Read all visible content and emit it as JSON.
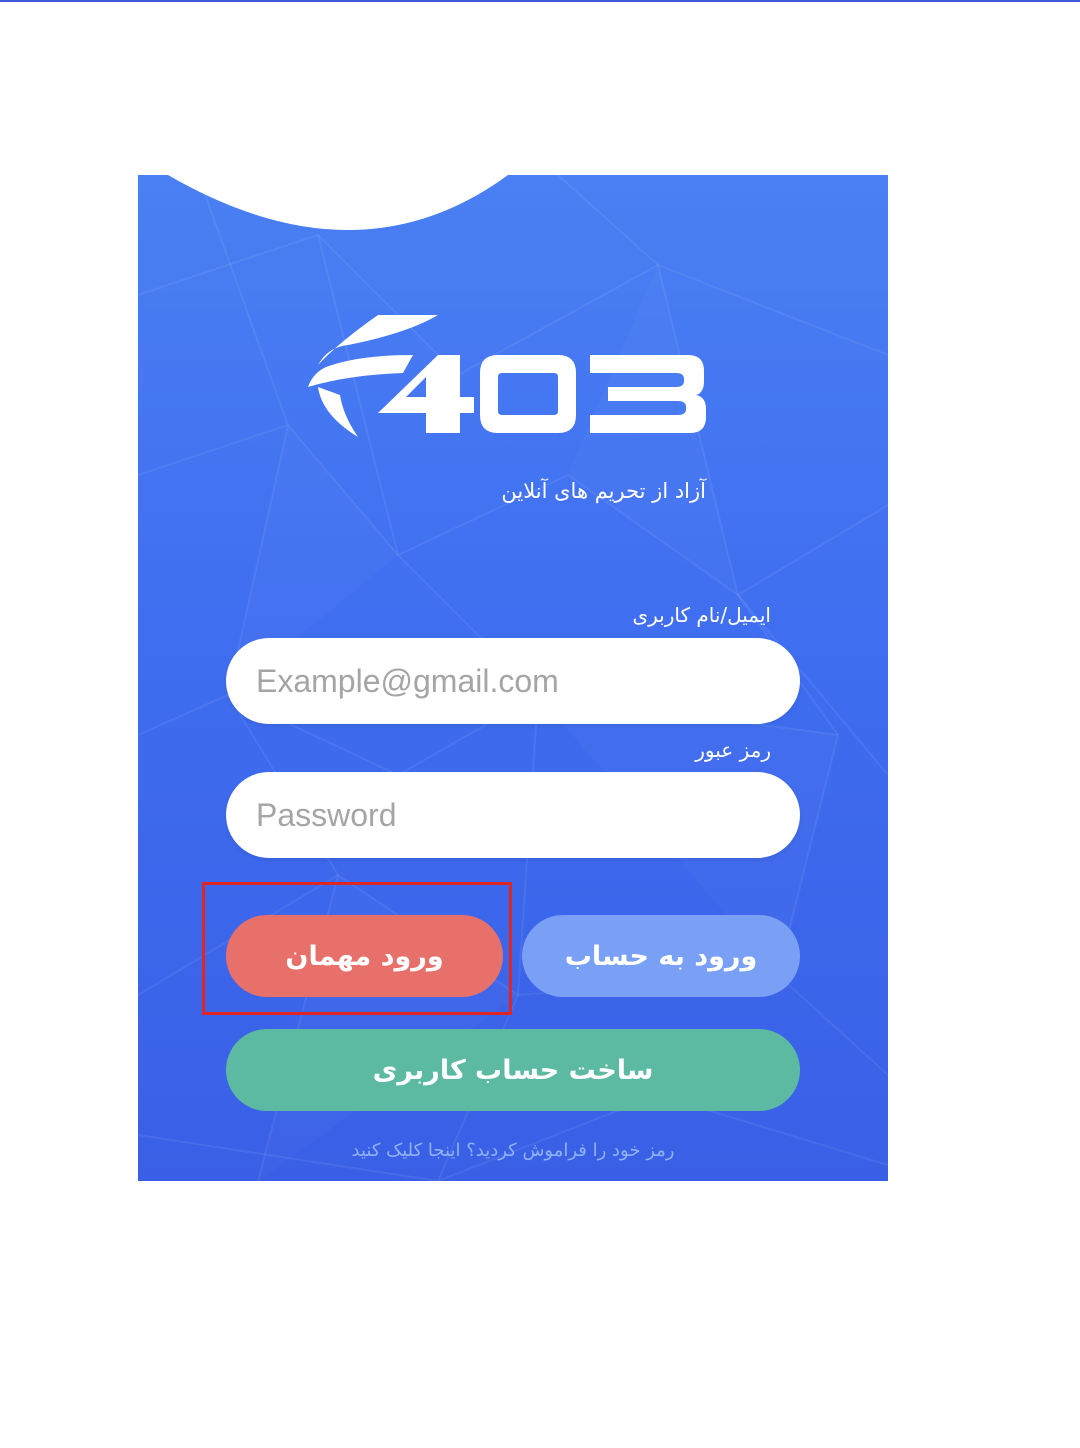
{
  "colors": {
    "panel_top": "#4a80f3",
    "panel_bottom": "#3a5fe6",
    "guest_button": "#e8706a",
    "login_button": "#7aa0f6",
    "signup_button": "#5cbaa3",
    "highlight": "#e02525"
  },
  "brand": {
    "logo_text": "403",
    "tagline": "آزاد از تحریم های آنلاین"
  },
  "form": {
    "email_label": "ایمیل/نام کاربری",
    "email_placeholder": "Example@gmail.com",
    "password_label": "رمز عبور",
    "password_placeholder": "Password"
  },
  "buttons": {
    "guest_label": "ورود مهمان",
    "login_label": "ورود به حساب",
    "signup_label": "ساخت حساب کاربری"
  },
  "links": {
    "forgot_password": "رمز خود را فراموش کردید؟ اینجا کلیک کنید"
  },
  "icons": {
    "logo": "403-wing-logo"
  }
}
